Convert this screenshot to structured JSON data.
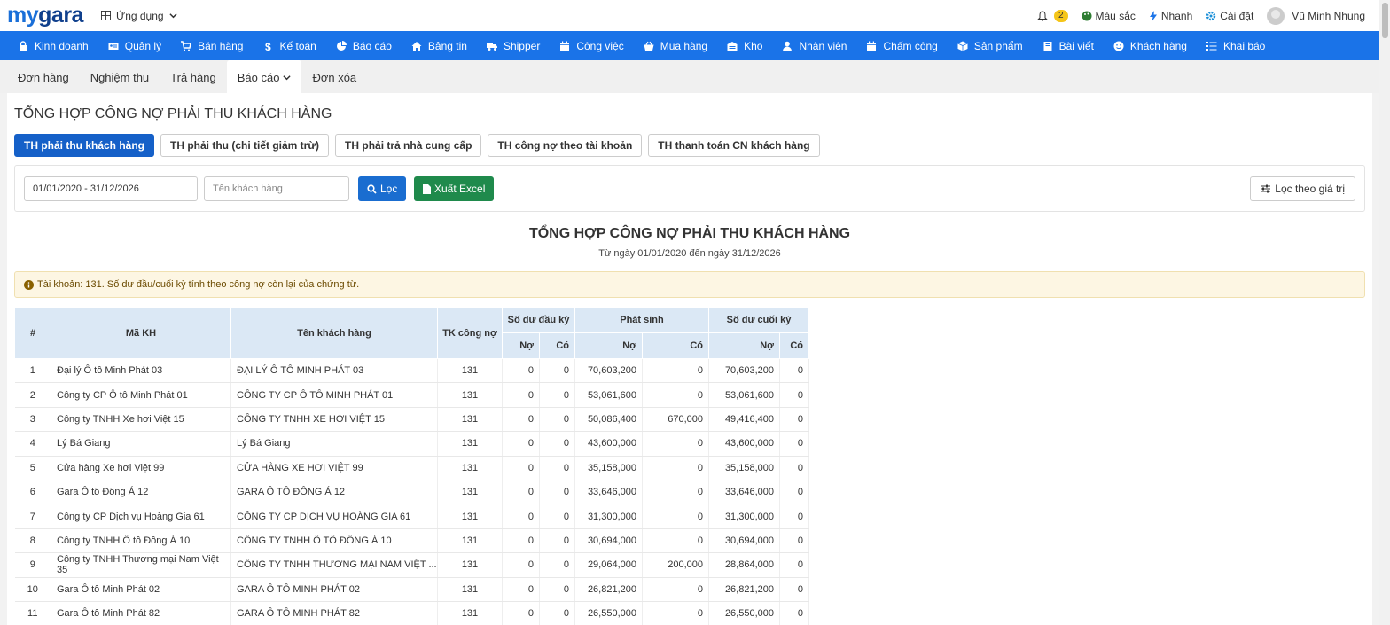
{
  "brand": {
    "part1": "my",
    "part2": "gara"
  },
  "apps_menu": {
    "label": "Ứng dụng"
  },
  "topright": {
    "notif_count": "2",
    "color_label": "Màu sắc",
    "quick_label": "Nhanh",
    "settings_label": "Cài đặt",
    "user_name": "Vũ Minh Nhung"
  },
  "nav": [
    {
      "label": "Kinh doanh",
      "icon": "lock-icon"
    },
    {
      "label": "Quản lý",
      "icon": "id-card-icon"
    },
    {
      "label": "Bán hàng",
      "icon": "cart-icon"
    },
    {
      "label": "Kế toán",
      "icon": "dollar-icon"
    },
    {
      "label": "Báo cáo",
      "icon": "pie-chart-icon"
    },
    {
      "label": "Bảng tin",
      "icon": "home-icon"
    },
    {
      "label": "Shipper",
      "icon": "truck-icon"
    },
    {
      "label": "Công việc",
      "icon": "calendar-icon"
    },
    {
      "label": "Mua hàng",
      "icon": "basket-icon"
    },
    {
      "label": "Kho",
      "icon": "warehouse-icon"
    },
    {
      "label": "Nhân viên",
      "icon": "user-icon"
    },
    {
      "label": "Chấm công",
      "icon": "calendar-icon"
    },
    {
      "label": "Sản phẩm",
      "icon": "box-icon"
    },
    {
      "label": "Bài viết",
      "icon": "book-icon"
    },
    {
      "label": "Khách hàng",
      "icon": "smile-icon"
    },
    {
      "label": "Khai báo",
      "icon": "list-icon"
    }
  ],
  "subtabs": [
    "Đơn hàng",
    "Nghiệm thu",
    "Trả hàng",
    "Báo cáo",
    "Đơn xóa"
  ],
  "page_title": "TỔNG HỢP CÔNG NỢ PHẢI THU KHÁCH HÀNG",
  "report_tabs": [
    "TH phải thu khách hàng",
    "TH phải thu (chi tiết giảm trừ)",
    "TH phải trả nhà cung cấp",
    "TH công nợ theo tài khoản",
    "TH thanh toán CN khách hàng"
  ],
  "filter": {
    "date_range": "01/01/2020 - 31/12/2026",
    "customer_placeholder": "Tên khách hàng",
    "filter_btn": "Lọc",
    "excel_btn": "Xuất Excel",
    "value_filter_btn": "Lọc theo giá trị"
  },
  "report": {
    "title": "TỔNG HỢP CÔNG NỢ PHẢI THU KHÁCH HÀNG",
    "subtitle": "Từ ngày 01/01/2020 đến ngày 31/12/2026",
    "note": "Tài khoản: 131. Số dư đầu/cuối kỳ tính theo công nợ còn lại của chứng từ."
  },
  "table": {
    "headers": {
      "num": "#",
      "code": "Mã KH",
      "name": "Tên khách hàng",
      "account": "TK công nợ",
      "opening": "Số dư đầu kỳ",
      "movement": "Phát sinh",
      "closing": "Số dư cuối kỳ",
      "debit": "Nợ",
      "credit": "Có"
    },
    "rows": [
      [
        "1",
        "Đại lý Ô tô Minh Phát 03",
        "ĐẠI LÝ Ô TÔ MINH PHÁT 03",
        "131",
        "0",
        "0",
        "70,603,200",
        "0",
        "70,603,200",
        "0"
      ],
      [
        "2",
        "Công ty CP Ô tô Minh Phát 01",
        "CÔNG TY CP Ô TÔ MINH PHÁT 01",
        "131",
        "0",
        "0",
        "53,061,600",
        "0",
        "53,061,600",
        "0"
      ],
      [
        "3",
        "Công ty TNHH Xe hơi Việt 15",
        "CÔNG TY TNHH XE HƠI VIỆT 15",
        "131",
        "0",
        "0",
        "50,086,400",
        "670,000",
        "49,416,400",
        "0"
      ],
      [
        "4",
        "Lý Bá Giang",
        "Lý Bá Giang",
        "131",
        "0",
        "0",
        "43,600,000",
        "0",
        "43,600,000",
        "0"
      ],
      [
        "5",
        "Cửa hàng Xe hơi Việt 99",
        "CỬA HÀNG XE HƠI VIỆT 99",
        "131",
        "0",
        "0",
        "35,158,000",
        "0",
        "35,158,000",
        "0"
      ],
      [
        "6",
        "Gara Ô tô Đông Á 12",
        "GARA Ô TÔ ĐÔNG Á 12",
        "131",
        "0",
        "0",
        "33,646,000",
        "0",
        "33,646,000",
        "0"
      ],
      [
        "7",
        "Công ty CP Dịch vụ Hoàng Gia 61",
        "CÔNG TY CP DỊCH VỤ HOÀNG GIA 61",
        "131",
        "0",
        "0",
        "31,300,000",
        "0",
        "31,300,000",
        "0"
      ],
      [
        "8",
        "Công ty TNHH Ô tô Đông Á 10",
        "CÔNG TY TNHH Ô TÔ ĐÔNG Á 10",
        "131",
        "0",
        "0",
        "30,694,000",
        "0",
        "30,694,000",
        "0"
      ],
      [
        "9",
        "Công ty TNHH Thương mại Nam Việt 35",
        "CÔNG TY TNHH THƯƠNG MẠI NAM VIỆT ...",
        "131",
        "0",
        "0",
        "29,064,000",
        "200,000",
        "28,864,000",
        "0"
      ],
      [
        "10",
        "Gara Ô tô Minh Phát 02",
        "GARA Ô TÔ MINH PHÁT 02",
        "131",
        "0",
        "0",
        "26,821,200",
        "0",
        "26,821,200",
        "0"
      ],
      [
        "11",
        "Gara Ô tô Minh Phát 82",
        "GARA Ô TÔ MINH PHÁT 82",
        "131",
        "0",
        "0",
        "26,550,000",
        "0",
        "26,550,000",
        "0"
      ]
    ]
  },
  "colors": {
    "nav_bg": "#1a73e8",
    "primary_btn": "#1560c8",
    "excel_btn": "#1f8a4c",
    "header_bg": "#dbe8f5"
  }
}
